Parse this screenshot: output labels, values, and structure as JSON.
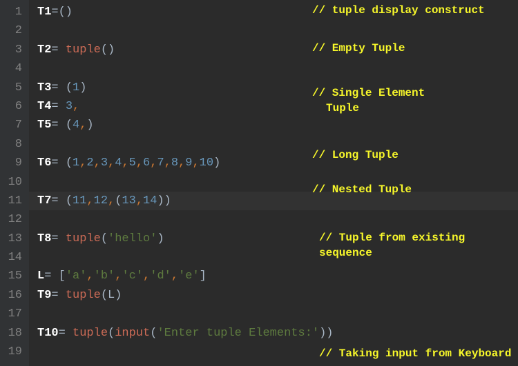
{
  "lines": {
    "n1": "1",
    "n2": "2",
    "n3": "3",
    "n4": "4",
    "n5": "5",
    "n6": "6",
    "n7": "7",
    "n8": "8",
    "n9": "9",
    "n10": "10",
    "n11": "11",
    "n12": "12",
    "n13": "13",
    "n14": "14",
    "n15": "15",
    "n16": "16",
    "n17": "17",
    "n18": "18",
    "n19": "19"
  },
  "code": {
    "l1_var": "T1",
    "l1_op": "=",
    "l1_paren": "()",
    "l3_var": "T2",
    "l3_op": "= ",
    "l3_func": "tuple",
    "l3_paren": "()",
    "l5_var": "T3",
    "l5_op": "= ",
    "l5_po": "(",
    "l5_num": "1",
    "l5_pc": ")",
    "l6_var": "T4",
    "l6_op": "= ",
    "l6_num": "3",
    "l6_comma": ",",
    "l7_var": "T5",
    "l7_op": "= ",
    "l7_po": "(",
    "l7_num": "4",
    "l7_comma": ",",
    "l7_pc": ")",
    "l9_var": "T6",
    "l9_op": "= ",
    "l9_po": "(",
    "l9_n1": "1",
    "l9_c1": ",",
    "l9_n2": "2",
    "l9_c2": ",",
    "l9_n3": "3",
    "l9_c3": ",",
    "l9_n4": "4",
    "l9_c4": ",",
    "l9_n5": "5",
    "l9_c5": ",",
    "l9_n6": "6",
    "l9_c6": ",",
    "l9_n7": "7",
    "l9_c7": ",",
    "l9_n8": "8",
    "l9_c8": ",",
    "l9_n9": "9",
    "l9_c9": ",",
    "l9_n10": "10",
    "l9_pc": ")",
    "l11_var": "T7",
    "l11_op": "= ",
    "l11_po": "(",
    "l11_n1": "11",
    "l11_c1": ",",
    "l11_n2": "12",
    "l11_c2": ",",
    "l11_po2": "(",
    "l11_n3": "13",
    "l11_c3": ",",
    "l11_n4": "14",
    "l11_pc2": ")",
    "l11_pc": ")",
    "l13_var": "T8",
    "l13_op": "= ",
    "l13_func": "tuple",
    "l13_po": "(",
    "l13_str": "'hello'",
    "l13_pc": ")",
    "l15_var": "L",
    "l15_op": "= ",
    "l15_bo": "[",
    "l15_s1": "'a'",
    "l15_c1": ",",
    "l15_s2": "'b'",
    "l15_c2": ",",
    "l15_s3": "'c'",
    "l15_c3": ",",
    "l15_s4": "'d'",
    "l15_c4": ",",
    "l15_s5": "'e'",
    "l15_bc": "]",
    "l16_var": "T9",
    "l16_op": "= ",
    "l16_func": "tuple",
    "l16_po": "(",
    "l16_arg": "L",
    "l16_pc": ")",
    "l18_var": "T10",
    "l18_op": "= ",
    "l18_func": "tuple",
    "l18_po": "(",
    "l18_func2": "input",
    "l18_po2": "(",
    "l18_str": "'Enter tuple Elements:'",
    "l18_pc2": ")",
    "l18_pc": ")"
  },
  "comments": {
    "c1": "// tuple display construct",
    "c2": "// Empty Tuple",
    "c3a": "// Single Element",
    "c3b": "Tuple",
    "c4": "// Long Tuple",
    "c5": "// Nested Tuple",
    "c6a": "// Tuple from existing",
    "c6b": "sequence",
    "c7": "// Taking input from Keyboard"
  }
}
